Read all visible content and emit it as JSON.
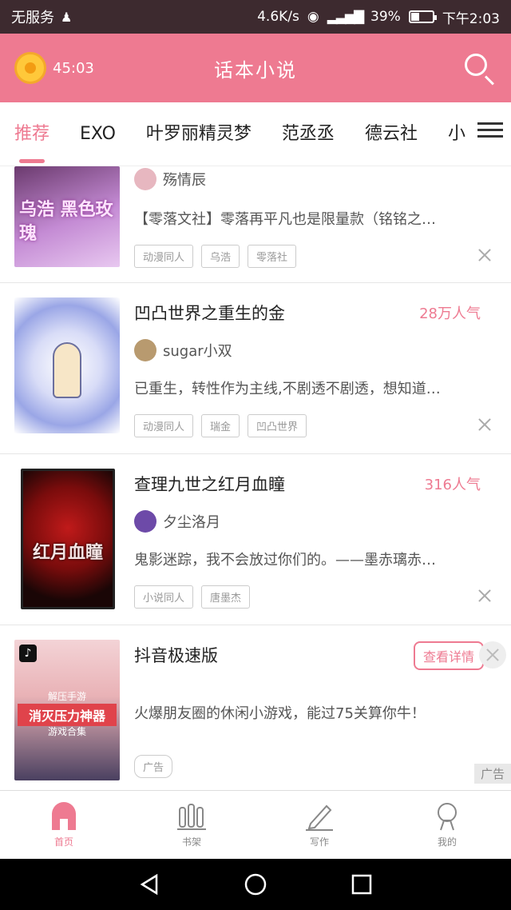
{
  "status_bar": {
    "carrier": "无服务",
    "speed": "4.6K/s",
    "battery": "39%",
    "time": "下午2:03",
    "battery_level": 0.39
  },
  "header": {
    "timer": "45:03",
    "title": "话本小说"
  },
  "tabs": [
    {
      "label": "推荐",
      "active": true
    },
    {
      "label": "EXO"
    },
    {
      "label": "叶罗丽精灵梦"
    },
    {
      "label": "范丞丞"
    },
    {
      "label": "德云社"
    },
    {
      "label": "小"
    }
  ],
  "feed": [
    {
      "author": "殇情辰",
      "summary": "【零落文社】零落再平凡也是限量款（铭铭之…",
      "tags": [
        "动漫同人",
        "乌浩",
        "零落社"
      ],
      "cover_text": "乌浩 黑色玫瑰"
    },
    {
      "title": "凹凸世界之重生的金",
      "popularity": "28万人气",
      "author": "sugar小双",
      "summary": "已重生，转性作为主线,不剧透不剧透，想知道…",
      "tags": [
        "动漫同人",
        "瑞金",
        "凹凸世界"
      ]
    },
    {
      "title": "查理九世之红月血瞳",
      "popularity": "316人气",
      "author": "夕尘洛月",
      "summary": "鬼影迷踪，我不会放过你们的。——墨赤璃赤…",
      "tags": [
        "小说同人",
        "唐墨杰"
      ],
      "cover_text": "红月血瞳"
    },
    {
      "title": "抖音极速版",
      "button": "查看详情",
      "summary": "火爆朋友圈的休闲小游戏，能过75关算你牛！",
      "tags": [
        "广告"
      ],
      "ad_label": "广告",
      "cover_text_1": "解压手游",
      "cover_text_2": "消灭压力神器",
      "cover_text_3": "游戏合集"
    }
  ],
  "bottom_nav": [
    {
      "label": "首页",
      "icon": "home-icon",
      "active": true
    },
    {
      "label": "书架",
      "icon": "bookshelf-icon"
    },
    {
      "label": "写作",
      "icon": "pen-icon"
    },
    {
      "label": "我的",
      "icon": "profile-icon"
    }
  ],
  "colors": {
    "accent": "#ee7a91",
    "status_bar": "#3d2a2f"
  }
}
